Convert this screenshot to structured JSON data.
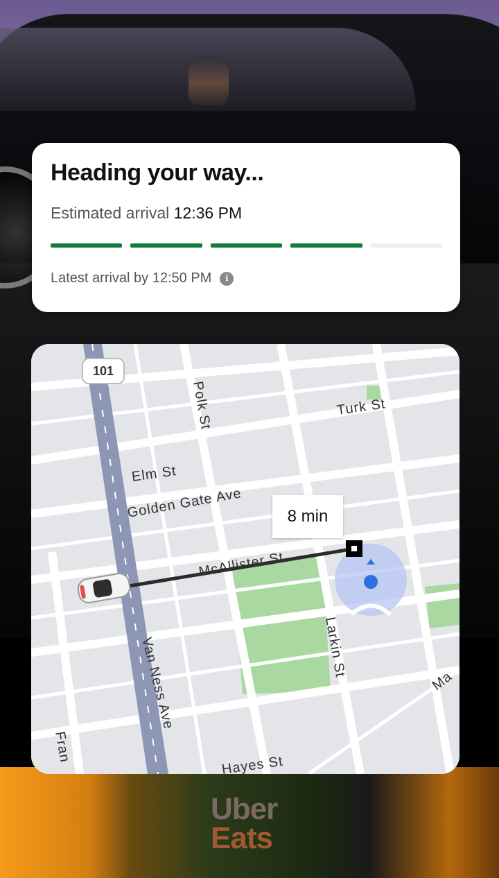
{
  "status_card": {
    "title": "Heading your way...",
    "eta_label": "Estimated arrival",
    "eta_time": "12:36 PM",
    "progress": {
      "segments_total": 5,
      "segments_filled": 4,
      "color": "#117a3d"
    },
    "latest_label": "Latest arrival by 12:50 PM",
    "info_icon": "info-icon"
  },
  "map": {
    "eta_badge": "8 min",
    "highway_shield": "101",
    "streets": {
      "turk": "Turk St",
      "elm": "Elm St",
      "golden_gate": "Golden Gate Ave",
      "mcallister": "McAllister St",
      "polk": "Polk St",
      "larkin": "Larkin St",
      "van_ness": "Van Ness Ave",
      "hayes": "Hayes St",
      "fran": "Fran",
      "ma": "Ma"
    },
    "colors": {
      "route": "#2b2b2b",
      "highway": "#8e96b6",
      "park": "#a9d8a0",
      "user_dot": "#2f6fe0"
    }
  },
  "background": {
    "brand_line1": "Uber",
    "brand_line2": "Eats"
  }
}
